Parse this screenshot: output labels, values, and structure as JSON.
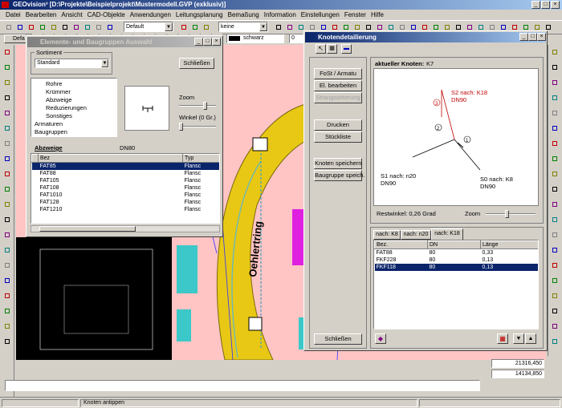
{
  "app": {
    "title": "GEOvision³  [D:\\Projekte\\Beispielprojekt\\Mustermodell.GVP (exklusiv)]",
    "menu": [
      "Datei",
      "Bearbeiten",
      "Ansicht",
      "CAD-Objekte",
      "Anwendungen",
      "Leitungsplanung",
      "Bemaßung",
      "Information",
      "Einstellungen",
      "Fenster",
      "Hilfe"
    ],
    "toolbar": {
      "layer_select": "Default",
      "linetype_select": "keine",
      "color_select": "schwarz",
      "width_value": "0",
      "doc_tab": "Defa"
    },
    "status": {
      "hint": "Knoten antippen",
      "coord_x": "21316,450",
      "coord_y": "14134,850"
    }
  },
  "map": {
    "street_label": "Oehlertring"
  },
  "elements_dialog": {
    "title": "Elemente- und Baugruppen Auswahl",
    "sortiment_label": "Sortiment",
    "sortiment_value": "Standard",
    "close_button": "Schließen",
    "zoom_label": "Zoom",
    "angle_label": "Winkel (0 Gr.)",
    "tree": [
      "Rohre",
      "Krümmer",
      "Abzweige",
      "Reduzierungen",
      "Sonstiges",
      "Armaturen",
      "Baugruppen"
    ],
    "group_label": "Abzweige",
    "group_dn": "DN80",
    "table_headers": [
      "Bez",
      "Typ"
    ],
    "rows": [
      {
        "bez": "FAT85",
        "typ": "Flansc"
      },
      {
        "bez": "FAT88",
        "typ": "Flansc"
      },
      {
        "bez": "FAT105",
        "typ": "Flansc"
      },
      {
        "bez": "FAT108",
        "typ": "Flansc"
      },
      {
        "bez": "FAT1010",
        "typ": "Flansc"
      },
      {
        "bez": "FAT128",
        "typ": "Flansc"
      },
      {
        "bez": "FAT1210",
        "typ": "Flansc"
      }
    ]
  },
  "knoten_dialog": {
    "title": "Knotendetailierung",
    "buttons": [
      "FoSt / Armatu",
      "El. bearbeiten",
      "Strangsortierung",
      "Drucken",
      "Stückliste",
      "Knoten speichern",
      "Baugruppe speich."
    ],
    "close_button": "Schließen",
    "current_label": "aktueller Knoten:",
    "current_value": "K7",
    "diagram": {
      "s2": "S2 nach: K18",
      "s2_dn": "DN90",
      "s1": "S1 nach: n20",
      "s1_dn": "DN90",
      "s0": "S0 nach: K8",
      "s0_dn": "DN90",
      "n1": "1",
      "n2": "2",
      "n3": "3"
    },
    "restwinkel": "Restwinkel:  0,26 Grad",
    "zoom_label": "Zoom",
    "tabs": [
      "nach: K8",
      "nach: n20",
      "nach: K18"
    ],
    "table_headers": [
      "Bez.",
      "DN",
      "Länge"
    ],
    "rows": [
      {
        "bez": "FAT88",
        "dn": "80",
        "len": "0,33"
      },
      {
        "bez": "FKF228",
        "dn": "80",
        "len": "0,13"
      },
      {
        "bez": "FKF118",
        "dn": "80",
        "len": "0,13"
      }
    ]
  }
}
